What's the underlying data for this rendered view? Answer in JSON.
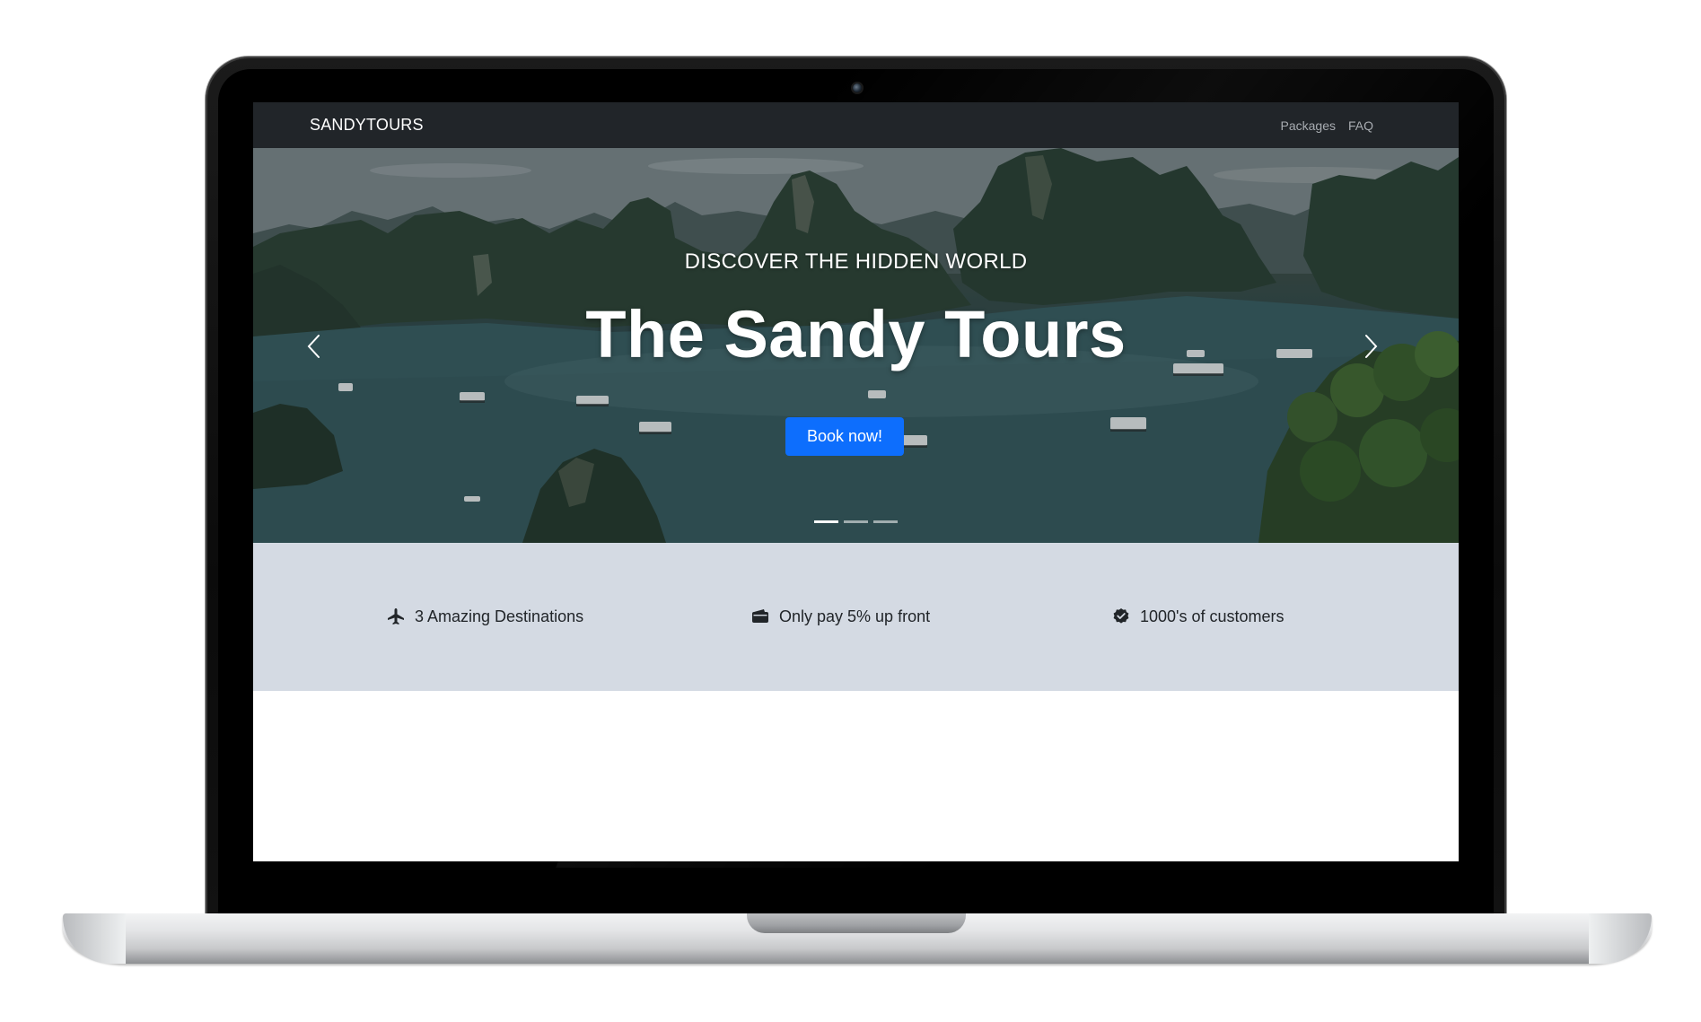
{
  "navbar": {
    "brand": "SANDYTOURS",
    "links": [
      {
        "label": "Packages"
      },
      {
        "label": "FAQ"
      }
    ]
  },
  "hero": {
    "subtitle": "DISCOVER THE HIDDEN WORLD",
    "title": "The Sandy Tours",
    "cta_label": "Book now!",
    "prev_icon": "chevron-left-icon",
    "next_icon": "chevron-right-icon",
    "slides_count": 3,
    "active_slide": 1
  },
  "features": [
    {
      "icon": "airplane-icon",
      "label": "3 Amazing Destinations"
    },
    {
      "icon": "wallet-icon",
      "label": "Only pay 5% up front"
    },
    {
      "icon": "check-badge-icon",
      "label": "1000's of customers"
    }
  ],
  "colors": {
    "navbar_bg": "#212529",
    "primary_button": "#0d6efd",
    "features_bg": "#d4dae3"
  }
}
